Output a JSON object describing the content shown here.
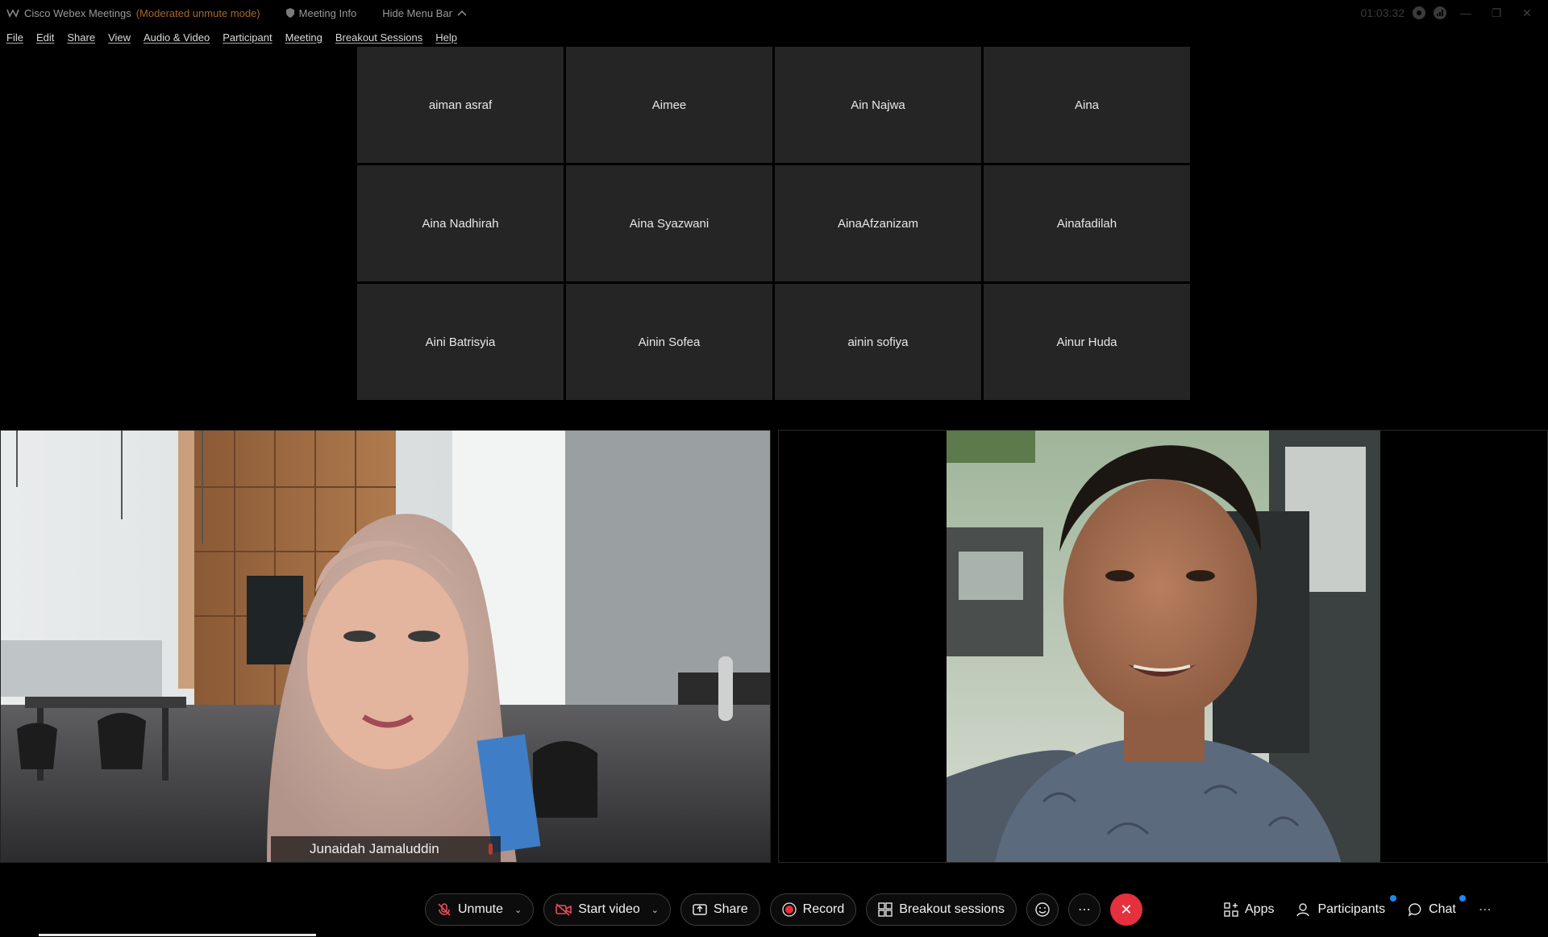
{
  "titlebar": {
    "app_name": "Cisco Webex Meetings",
    "mode": "(Moderated unmute mode)",
    "meeting_info": "Meeting Info",
    "hide_menu_bar": "Hide Menu Bar",
    "timer": "01:03:32"
  },
  "menu": {
    "items": [
      "File",
      "Edit",
      "Share",
      "View",
      "Audio & Video",
      "Participant",
      "Meeting",
      "Breakout Sessions",
      "Help"
    ]
  },
  "grid": {
    "participants": [
      "aiman asraf",
      "Aimee",
      "Ain Najwa",
      "Aina",
      "Aina Nadhirah",
      "Aina Syazwani",
      "AinaAfzanizam",
      "Ainafadilah",
      "Aini Batrisyia",
      "Ainin Sofea",
      "ainin sofiya",
      "Ainur Huda"
    ]
  },
  "videos": {
    "left_name": "Junaidah Jamaluddin"
  },
  "controls": {
    "unmute": "Unmute",
    "start_video": "Start video",
    "share": "Share",
    "record": "Record",
    "breakout": "Breakout sessions",
    "apps": "Apps",
    "participants": "Participants",
    "chat": "Chat"
  },
  "colors": {
    "end_button": "#e5303e",
    "notification_dot": "#1d8af0",
    "moderated_text": "#a8672a",
    "tile_bg": "#252525"
  }
}
